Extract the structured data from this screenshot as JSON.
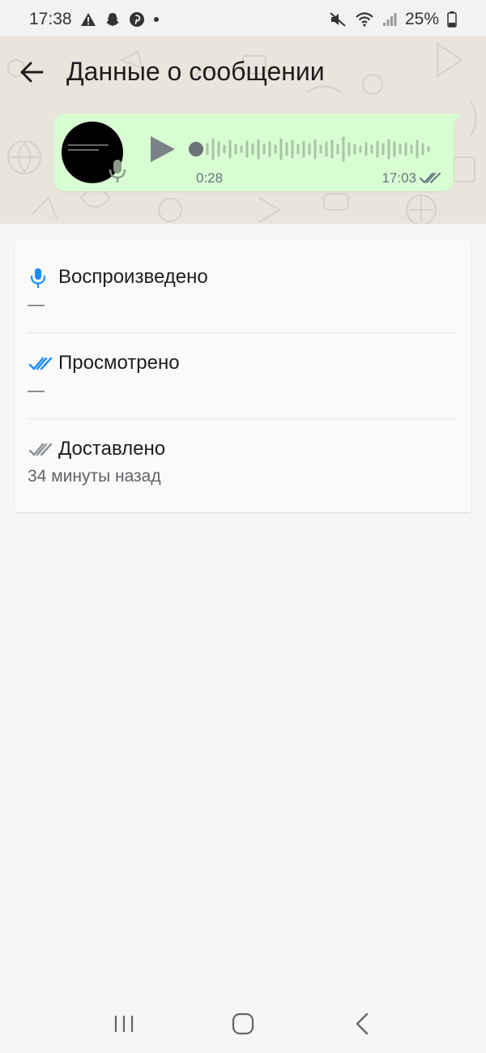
{
  "status_bar": {
    "time": "17:38",
    "left_icons": [
      "warning-icon",
      "snapchat-icon",
      "pinterest-icon",
      "dot-icon"
    ],
    "right_icons": [
      "mute-icon",
      "wifi-icon",
      "signal-icon",
      "battery-icon"
    ],
    "battery": "25%"
  },
  "header": {
    "title": "Данные о сообщении",
    "back_icon": "arrow-left-icon"
  },
  "voice_message": {
    "duration": "0:28",
    "time": "17:03",
    "status_icon": "double-check-icon",
    "bubble_color": "#d8fdd2"
  },
  "info": {
    "rows": [
      {
        "icon": "mic-icon",
        "label": "Воспроизведено",
        "value": "—",
        "icon_color": "#1a8cff"
      },
      {
        "icon": "double-check-icon",
        "label": "Просмотрено",
        "value": "—",
        "icon_color": "#1a8cff"
      },
      {
        "icon": "double-check-icon",
        "label": "Доставлено",
        "value": "34 минуты назад",
        "icon_color": "#8a8f94"
      }
    ]
  },
  "navbar": {
    "items": [
      "recents-icon",
      "home-icon",
      "back-icon"
    ]
  }
}
